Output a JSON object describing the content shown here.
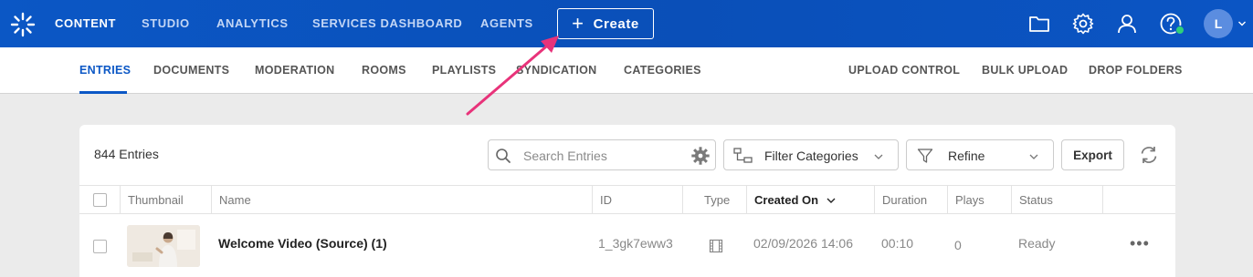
{
  "topnav": {
    "items": [
      "CONTENT",
      "STUDIO",
      "ANALYTICS",
      "SERVICES DASHBOARD",
      "AGENTS"
    ],
    "create_label": "Create",
    "avatar_initial": "L"
  },
  "subnav": {
    "left_tabs": [
      "ENTRIES",
      "DOCUMENTS",
      "MODERATION",
      "ROOMS",
      "PLAYLISTS",
      "SYNDICATION",
      "CATEGORIES"
    ],
    "right_tabs": [
      "UPLOAD CONTROL",
      "BULK UPLOAD",
      "DROP FOLDERS"
    ]
  },
  "toolbar": {
    "entries_count": "844 Entries",
    "search_placeholder": "Search Entries",
    "filter_categories_label": "Filter Categories",
    "refine_label": "Refine",
    "export_label": "Export"
  },
  "table": {
    "columns": [
      "Thumbnail",
      "Name",
      "ID",
      "Type",
      "Created On",
      "Duration",
      "Plays",
      "Status"
    ],
    "rows": [
      {
        "name": "Welcome Video (Source) (1)",
        "id": "1_3gk7eww3",
        "created_on": "02/09/2026 14:06",
        "duration": "00:10",
        "plays": "0",
        "status": "Ready"
      }
    ]
  },
  "icons": {
    "logo": "kaltura-logo-icon",
    "folder": "folder-icon",
    "settings": "gear-icon",
    "user": "user-icon",
    "help": "help-icon",
    "type": "video-film-icon",
    "refresh": "refresh-icon"
  },
  "colors": {
    "topbar": "#0b57c5",
    "accent": "#0b57c5",
    "annotation_arrow": "#e8337a",
    "status_dot": "#2fd07a"
  }
}
